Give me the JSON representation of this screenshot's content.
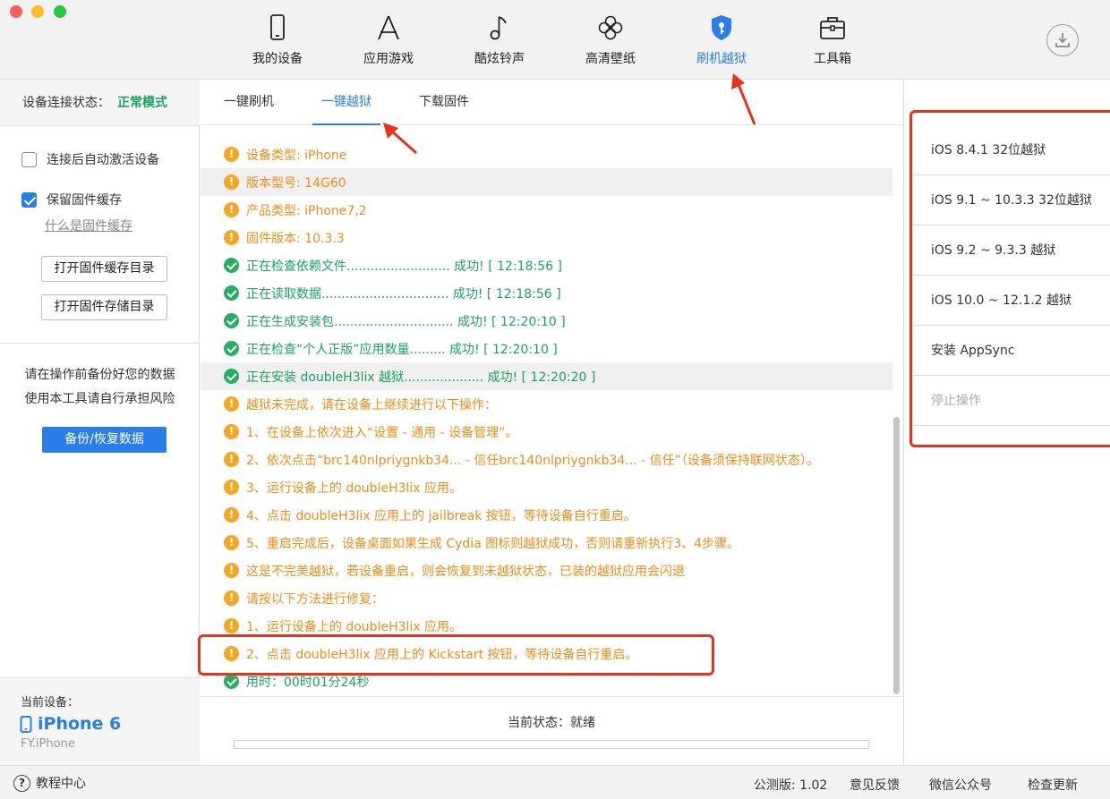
{
  "toolbar": {
    "nav": [
      {
        "label": "我的设备",
        "icon": "phone-icon"
      },
      {
        "label": "应用游戏",
        "icon": "app-store-icon"
      },
      {
        "label": "酷炫铃声",
        "icon": "music-note-icon"
      },
      {
        "label": "高清壁纸",
        "icon": "flower-icon"
      },
      {
        "label": "刷机越狱",
        "icon": "shield-key-icon",
        "active": true
      },
      {
        "label": "工具箱",
        "icon": "toolbox-icon"
      }
    ],
    "download_icon": "download-icon"
  },
  "sidebar": {
    "conn_label": "设备连接状态：",
    "conn_value": "正常模式",
    "auto_activate": "连接后自动激活设备",
    "keep_cache": "保留固件缓存",
    "cache_link": "什么是固件缓存",
    "open_cache_dir": "打开固件缓存目录",
    "open_store_dir": "打开固件存储目录",
    "warning_line1": "请在操作前备份好您的数据",
    "warning_line2": "使用本工具请自行承担风险",
    "backup_button": "备份/恢复数据",
    "device_caption": "当前设备：",
    "device_name": "iPhone 6",
    "device_user": "FY.iPhone"
  },
  "tabs": [
    {
      "label": "一键刷机"
    },
    {
      "label": "一键越狱",
      "active": true
    },
    {
      "label": "下载固件"
    }
  ],
  "log": [
    {
      "type": "warn",
      "text": "设备类型: iPhone"
    },
    {
      "type": "warn",
      "text": "版本型号: 14G60"
    },
    {
      "type": "warn",
      "text": "产品类型: iPhone7,2"
    },
    {
      "type": "warn",
      "text": "固件版本: 10.3.3"
    },
    {
      "type": "ok",
      "text": "正在检查依赖文件.......................... 成功! [ 12:18:56 ]"
    },
    {
      "type": "ok",
      "text": "正在读取数据................................ 成功! [ 12:18:56 ]"
    },
    {
      "type": "ok",
      "text": "正在生成安装包.............................. 成功! [ 12:20:10 ]"
    },
    {
      "type": "ok",
      "text": "正在检查“个人正版”应用数量......... 成功! [ 12:20:10 ]"
    },
    {
      "type": "ok",
      "text": "正在安装 doubleH3lix 越狱.................... 成功! [ 12:20:20 ]"
    },
    {
      "type": "warn",
      "text": "越狱未完成，请在设备上继续进行以下操作："
    },
    {
      "type": "warn",
      "text": "1、在设备上依次进入“设置 - 通用 - 设备管理”。"
    },
    {
      "type": "warn",
      "text": "2、依次点击“brc140nlpriygnkb34... - 信任brc140nlpriygnkb34... - 信任”（设备须保持联网状态）。"
    },
    {
      "type": "warn",
      "text": "3、运行设备上的 doubleH3lix 应用。"
    },
    {
      "type": "warn",
      "text": "4、点击 doubleH3lix 应用上的 jailbreak 按钮，等待设备自行重启。"
    },
    {
      "type": "warn",
      "text": "5、重启完成后，设备桌面如果生成 Cydia 图标则越狱成功，否则请重新执行3、4步骤。"
    },
    {
      "type": "warn",
      "text": "这是不完美越狱，若设备重启，则会恢复到未越狱状态，已装的越狱应用会闪退"
    },
    {
      "type": "warn",
      "text": "请按以下方法进行修复："
    },
    {
      "type": "warn",
      "text": "1、运行设备上的 doubleH3lix 应用。"
    },
    {
      "type": "warn",
      "text": "2、点击 doubleH3lix 应用上的 Kickstart 按钮，等待设备自行重启。"
    },
    {
      "type": "ok",
      "text": "用时：00时01分24秒"
    }
  ],
  "status": {
    "text": "当前状态：就绪",
    "progress": 0
  },
  "options": [
    {
      "label": "iOS 8.4.1 32位越狱"
    },
    {
      "label": "iOS 9.1 ~ 10.3.3 32位越狱"
    },
    {
      "label": "iOS 9.2 ~ 9.3.3 越狱"
    },
    {
      "label": "iOS 10.0 ~ 12.1.2 越狱"
    },
    {
      "label": "安装 AppSync"
    },
    {
      "label": "停止操作",
      "disabled": true
    }
  ],
  "footer": {
    "help": "教程中心",
    "version": "公测版: 1.02",
    "feedback": "意见反馈",
    "wechat": "微信公众号",
    "update": "检查更新"
  },
  "colors": {
    "accent": "#2b7de9",
    "success": "#1aa260",
    "warning": "#f08c1a",
    "annotation": "#e8321c"
  }
}
